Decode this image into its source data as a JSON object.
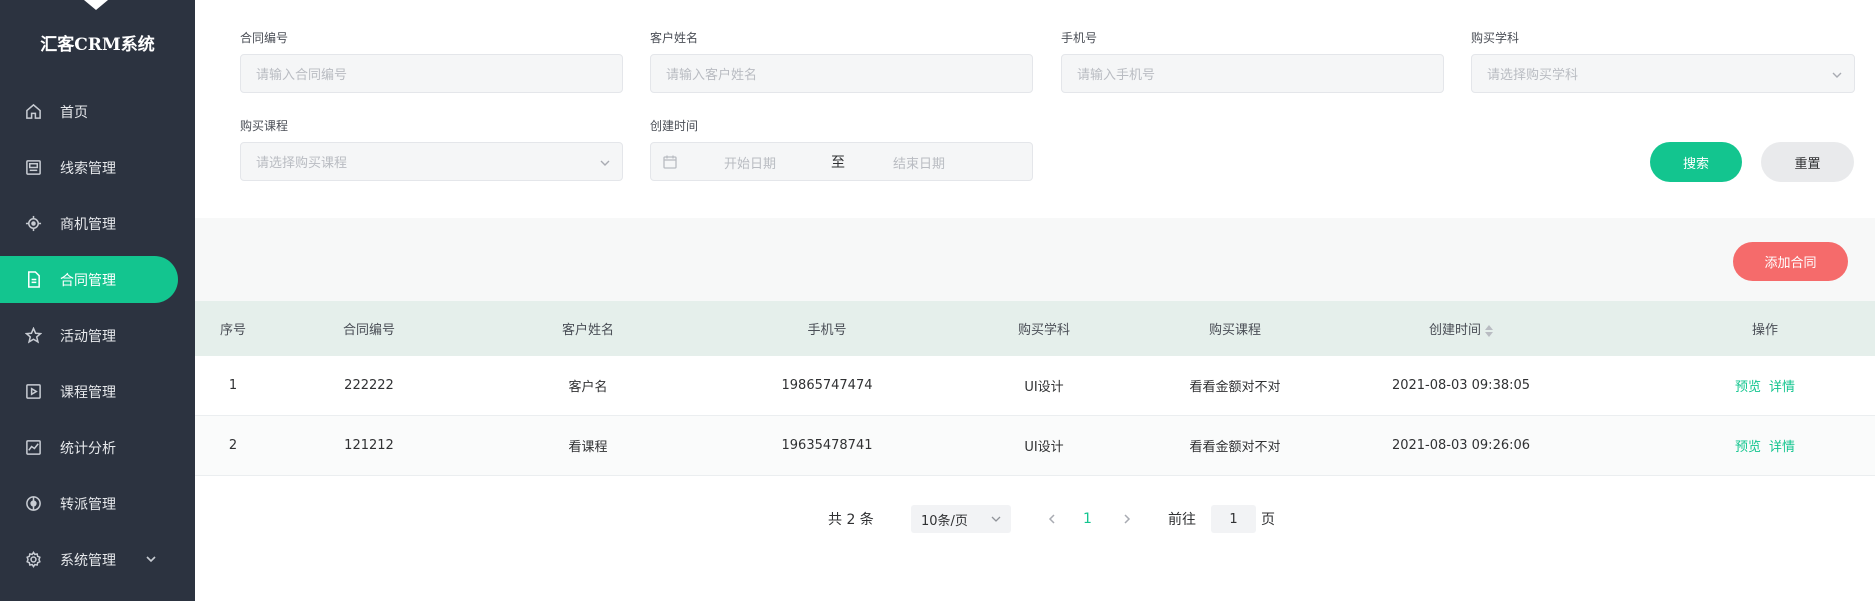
{
  "app": {
    "brand": "汇客CRM系统"
  },
  "sidebar": {
    "items": [
      {
        "label": "首页",
        "icon": "home-icon"
      },
      {
        "label": "线索管理",
        "icon": "clue-icon"
      },
      {
        "label": "商机管理",
        "icon": "target-icon"
      },
      {
        "label": "合同管理",
        "icon": "document-icon",
        "active": true
      },
      {
        "label": "活动管理",
        "icon": "star-icon"
      },
      {
        "label": "课程管理",
        "icon": "course-icon"
      },
      {
        "label": "统计分析",
        "icon": "chart-icon"
      },
      {
        "label": "转派管理",
        "icon": "transfer-icon"
      },
      {
        "label": "系统管理",
        "icon": "gear-icon",
        "expandable": true
      }
    ]
  },
  "filters": {
    "contract_no": {
      "label": "合同编号",
      "placeholder": "请输入合同编号"
    },
    "customer_name": {
      "label": "客户姓名",
      "placeholder": "请输入客户姓名"
    },
    "phone": {
      "label": "手机号",
      "placeholder": "请输入手机号"
    },
    "subject": {
      "label": "购买学科",
      "placeholder": "请选择购买学科"
    },
    "course": {
      "label": "购买课程",
      "placeholder": "请选择购买课程"
    },
    "created": {
      "label": "创建时间",
      "start_placeholder": "开始日期",
      "separator": "至",
      "end_placeholder": "结束日期"
    },
    "search_label": "搜索",
    "reset_label": "重置"
  },
  "toolbar": {
    "add_label": "添加合同"
  },
  "table": {
    "columns": [
      "序号",
      "合同编号",
      "客户姓名",
      "手机号",
      "购买学科",
      "购买课程",
      "创建时间",
      "操作"
    ],
    "rows": [
      {
        "index": "1",
        "contract_no": "222222",
        "customer": "客户名",
        "phone": "19865747474",
        "subject": "UI设计",
        "course": "看看金额对不对",
        "created": "2021-08-03 09:38:05"
      },
      {
        "index": "2",
        "contract_no": "121212",
        "customer": "看课程",
        "phone": "19635478741",
        "subject": "UI设计",
        "course": "看看金额对不对",
        "created": "2021-08-03 09:26:06"
      }
    ],
    "actions": {
      "preview": "预览",
      "detail": "详情"
    }
  },
  "pagination": {
    "total_text": "共 2 条",
    "page_size": "10条/页",
    "current_page": "1",
    "goto_prefix": "前往",
    "goto_value": "1",
    "goto_suffix": "页"
  },
  "colors": {
    "accent": "#13c58f",
    "danger": "#f56b6b",
    "sidebar_bg": "#2c3340",
    "header_row": "#e5efeb"
  }
}
